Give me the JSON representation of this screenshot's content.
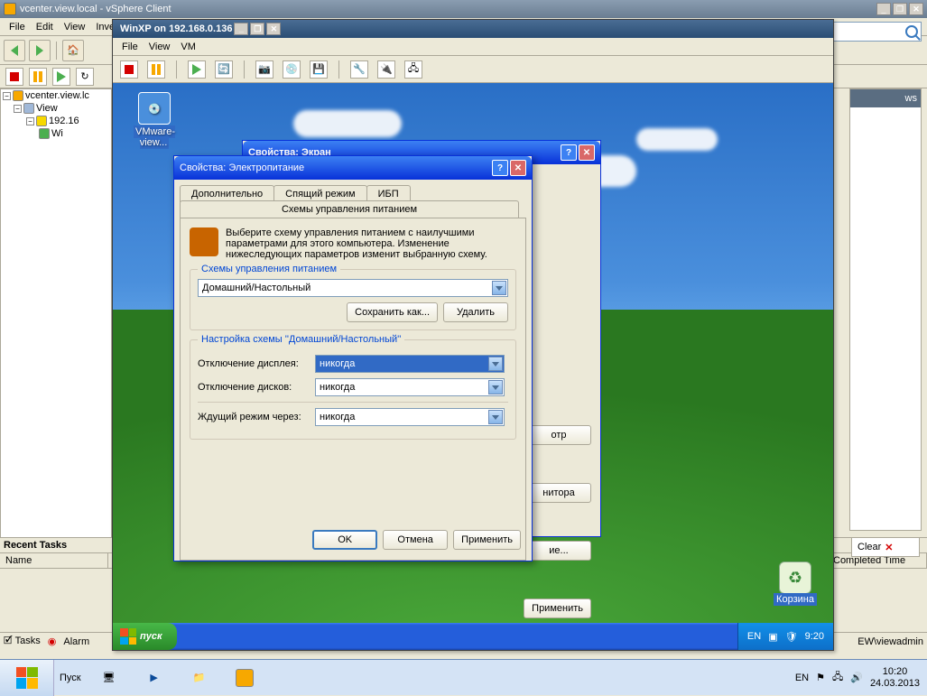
{
  "outer": {
    "title": "vcenter.view.local - vSphere Client",
    "menus": [
      "File",
      "Edit",
      "View",
      "Inve"
    ],
    "home_label": "H"
  },
  "tree": {
    "root": "vcenter.view.lc",
    "lvl2": "View",
    "lvl3": "192.16",
    "lvl4": "Wi"
  },
  "right": {
    "tab": "ws"
  },
  "recent": {
    "header": "Recent Tasks",
    "cols": [
      "Name"
    ],
    "clear": "Clear",
    "completed": "Completed Time"
  },
  "status": {
    "tasks": "Tasks",
    "alarms": "Alarm",
    "user": "EW\\viewadmin"
  },
  "vm": {
    "title": "WinXP on 192.168.0.136",
    "menus": [
      "File",
      "View",
      "VM"
    ],
    "desk_icon": "VMware-view...",
    "recycle": "Корзина",
    "start": "пуск",
    "lang": "EN",
    "clock": "9:20"
  },
  "display_dlg": {
    "title": "Свойства: Экран",
    "btn_view": "отр",
    "btn_monitor": "нитора",
    "btn_set": "ие...",
    "apply": "Применить"
  },
  "power_dlg": {
    "title": "Свойства: Электропитание",
    "tabs_front": "Схемы управления питанием",
    "tabs_back": [
      "Дополнительно",
      "Спящий режим",
      "ИБП"
    ],
    "intro": "Выберите схему управления питанием с наилучшими параметрами для этого компьютера. Изменение нижеследующих параметров изменит выбранную схему.",
    "group1_label": "Схемы управления питанием",
    "scheme_value": "Домашний/Настольный",
    "save_as": "Сохранить как...",
    "delete": "Удалить",
    "group2_label": "Настройка схемы ''Домашний/Настольный''",
    "row1": "Отключение дисплея:",
    "row2": "Отключение дисков:",
    "row3": "Ждущий режим через:",
    "never": "никогда",
    "ok": "OK",
    "cancel": "Отмена",
    "apply": "Применить"
  },
  "host_taskbar": {
    "start": "Пуск",
    "lang": "EN",
    "time": "10:20",
    "date": "24.03.2013"
  }
}
